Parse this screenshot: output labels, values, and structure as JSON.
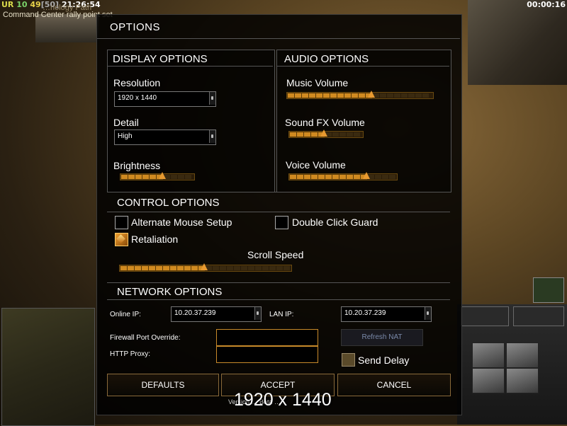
{
  "hud": {
    "ur": "UR",
    "cash1": "10",
    "cash2": "49",
    "bracket": "[50]",
    "clock": "21:26:54",
    "message_top": "…nology Path",
    "message_bottom": "Command Center rally point set",
    "timer": "00:00:16"
  },
  "dialog": {
    "title": "OPTIONS",
    "display": {
      "heading": "DISPLAY OPTIONS",
      "resolution_label": "Resolution",
      "resolution_value": "1920 x 1440",
      "detail_label": "Detail",
      "detail_value": "High",
      "brightness_label": "Brightness",
      "brightness_level": 0.55
    },
    "audio": {
      "heading": "AUDIO OPTIONS",
      "music_label": "Music Volume",
      "music_level": 0.6,
      "sfx_label": "Sound FX Volume",
      "sfx_level": 0.47,
      "voice_label": "Voice Volume",
      "voice_level": 0.7
    },
    "control": {
      "heading": "CONTROL OPTIONS",
      "alt_mouse_label": "Alternate Mouse Setup",
      "alt_mouse_checked": false,
      "double_click_label": "Double Click Guard",
      "double_click_checked": false,
      "retaliation_label": "Retaliation",
      "retaliation_checked": true,
      "scroll_label": "Scroll Speed",
      "scroll_level": 0.5
    },
    "network": {
      "heading": "NETWORK OPTIONS",
      "online_ip_label": "Online IP:",
      "online_ip_value": "10.20.37.239",
      "lan_ip_label": "LAN IP:",
      "lan_ip_value": "10.20.37.239",
      "firewall_label": "Firewall Port Override:",
      "firewall_value": "",
      "http_proxy_label": "HTTP Proxy:",
      "http_proxy_value": "",
      "refresh_nat_label": "Refresh NAT",
      "send_delay_label": "Send Delay",
      "send_delay_checked": false
    },
    "buttons": {
      "defaults": "DEFAULTS",
      "accept": "ACCEPT",
      "cancel": "CANCEL"
    },
    "version_text": "Version … Beta …",
    "overlay_resolution": "1920 x 1440"
  },
  "colors": {
    "accent": "#d08a20",
    "panel_border": "#555555",
    "dialog_bg": "#000000"
  }
}
